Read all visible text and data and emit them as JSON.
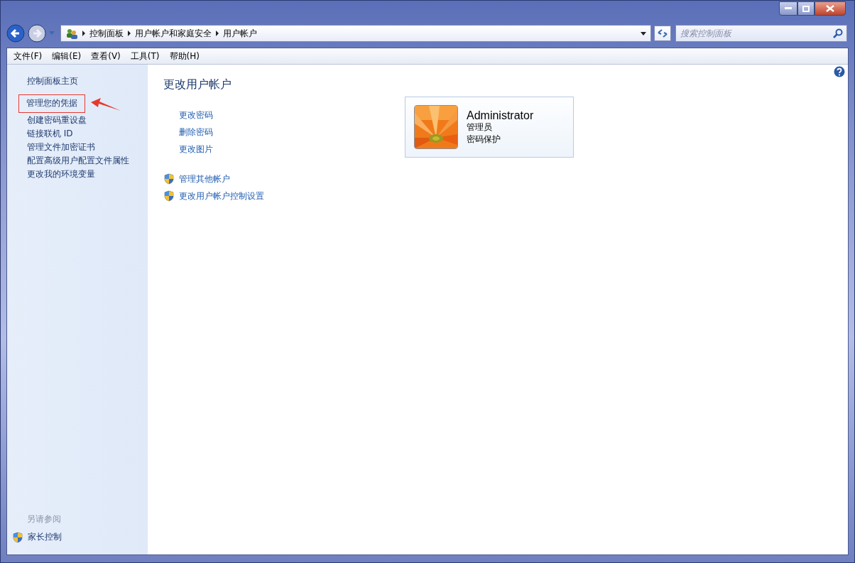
{
  "address_bar": {
    "crumbs": [
      "控制面板",
      "用户帐户和家庭安全",
      "用户帐户"
    ]
  },
  "search": {
    "placeholder": "搜索控制面板"
  },
  "menu_bar": [
    "文件(F)",
    "编辑(E)",
    "查看(V)",
    "工具(T)",
    "帮助(H)"
  ],
  "sidebar": {
    "items": [
      {
        "label": "控制面板主页",
        "highlighted": false
      },
      {
        "label": "管理您的凭据",
        "highlighted": true
      },
      {
        "label": "创建密码重设盘",
        "highlighted": false
      },
      {
        "label": "链接联机 ID",
        "highlighted": false
      },
      {
        "label": "管理文件加密证书",
        "highlighted": false
      },
      {
        "label": "配置高级用户配置文件属性",
        "highlighted": false
      },
      {
        "label": "更改我的环境变量",
        "highlighted": false
      }
    ],
    "see_also": {
      "heading": "另请参阅",
      "links": [
        "家长控制"
      ]
    }
  },
  "main": {
    "heading": "更改用户帐户",
    "links": [
      {
        "label": "更改密码",
        "shield": false
      },
      {
        "label": "删除密码",
        "shield": false
      },
      {
        "label": "更改图片",
        "shield": false
      }
    ],
    "admin_links": [
      {
        "label": "管理其他帐户",
        "shield": true
      },
      {
        "label": "更改用户帐户控制设置",
        "shield": true
      }
    ],
    "account": {
      "name": "Administrator",
      "role": "管理员",
      "status": "密码保护"
    }
  }
}
